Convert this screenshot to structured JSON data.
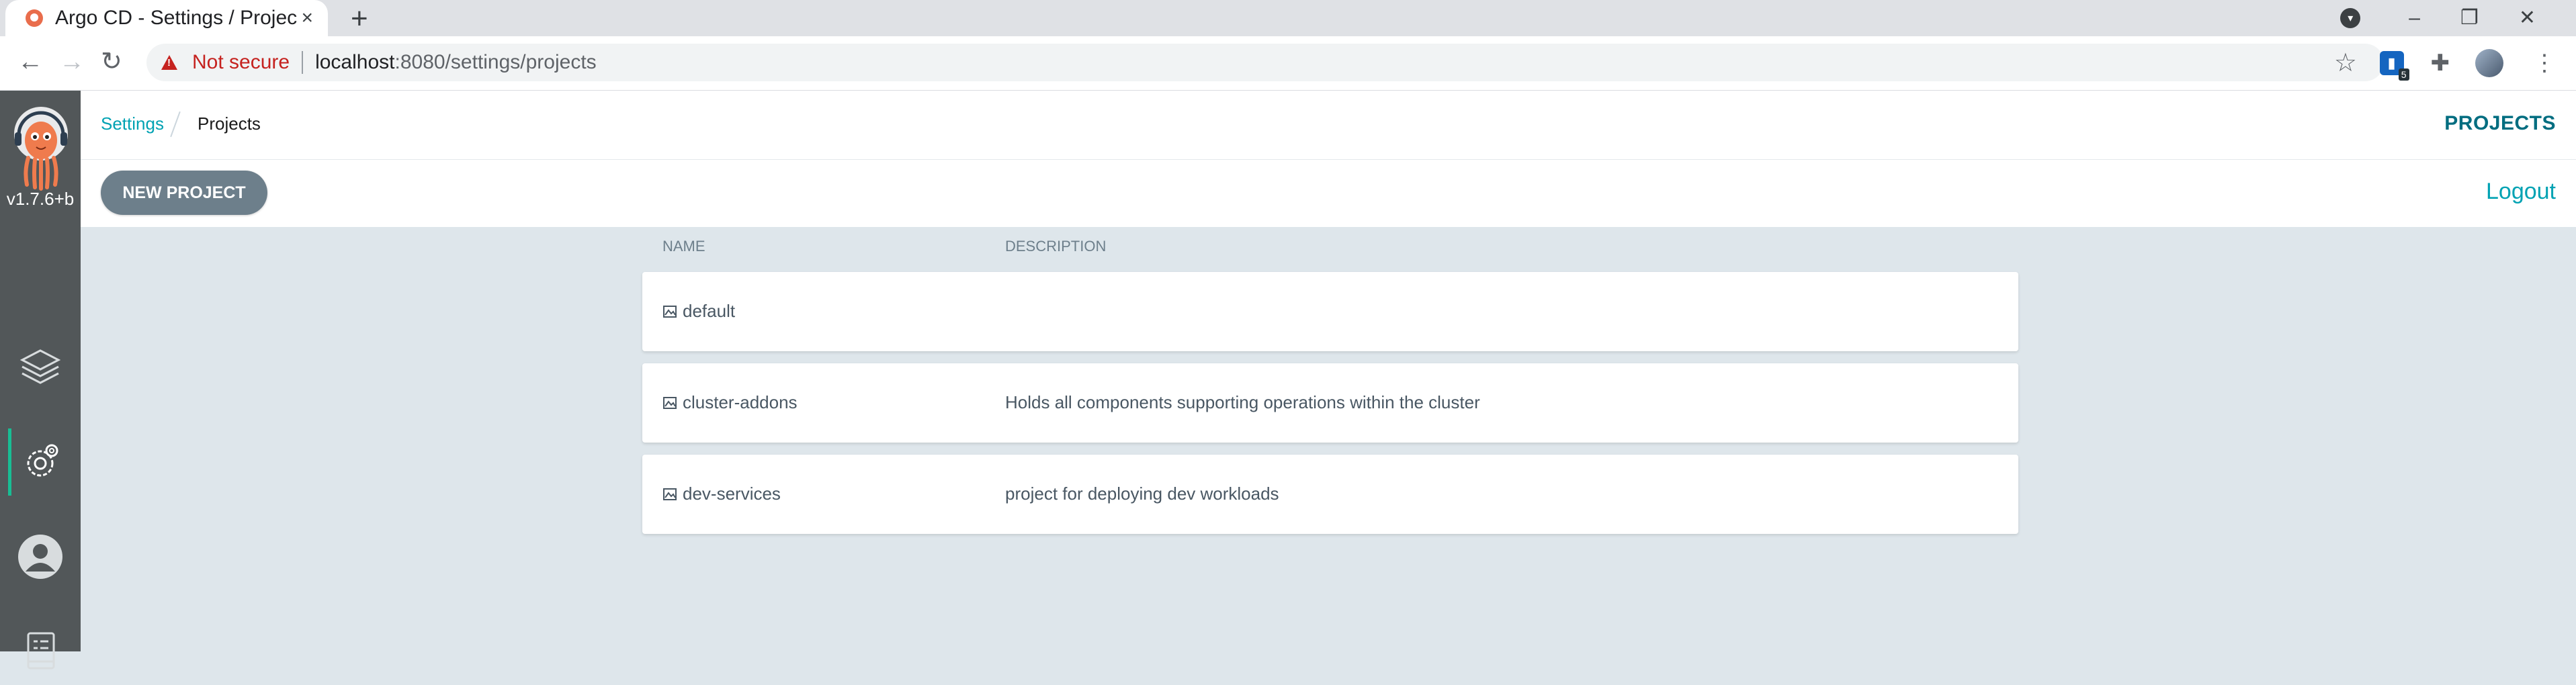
{
  "browser": {
    "tab_title": "Argo CD - Settings / Projects",
    "tab_close": "×",
    "new_tab": "+",
    "not_secure": "Not secure",
    "url_host": "localhost",
    "url_path": ":8080/settings/projects",
    "extension_badge": "5",
    "icons": [
      "back-icon",
      "forward-icon",
      "reload-icon",
      "warning-icon",
      "star-icon",
      "puzzle-icon",
      "menu-icon"
    ]
  },
  "sidebar": {
    "version": "v1.7.6+b",
    "items": [
      {
        "name": "applications",
        "icon": "layers-icon",
        "active": false
      },
      {
        "name": "settings",
        "icon": "gear-icon",
        "active": true
      },
      {
        "name": "user-info",
        "icon": "user-icon",
        "active": false
      },
      {
        "name": "docs",
        "icon": "docs-icon",
        "active": false
      }
    ]
  },
  "header": {
    "breadcrumb_settings": "Settings",
    "breadcrumb_current": "Projects",
    "title": "PROJECTS"
  },
  "actions": {
    "new_project": "NEW PROJECT",
    "logout": "Logout"
  },
  "table": {
    "col_name": "NAME",
    "col_description": "DESCRIPTION",
    "rows": [
      {
        "name": "default",
        "description": ""
      },
      {
        "name": "cluster-addons",
        "description": "Holds all components supporting operations within the cluster"
      },
      {
        "name": "dev-services",
        "description": "project for deploying dev workloads"
      }
    ]
  },
  "colors": {
    "accent": "#00a2b3",
    "sidebar": "#525759",
    "button": "#6d7f8b",
    "active_indicator": "#18be94",
    "background": "#dee6eb"
  }
}
